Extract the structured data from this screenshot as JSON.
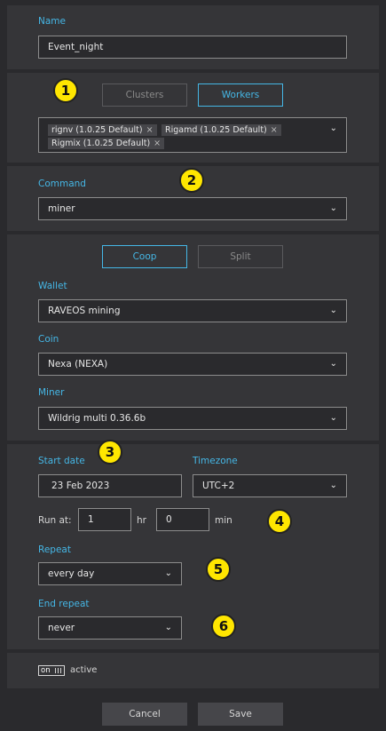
{
  "name": {
    "label": "Name",
    "value": "Event_night"
  },
  "target": {
    "options": [
      "Clusters",
      "Workers"
    ],
    "selected": "Workers",
    "tags": [
      "rignv (1.0.25 Default)",
      "Rigamd (1.0.25 Default)",
      "Rigmix (1.0.25 Default)"
    ],
    "remove_glyph": "×"
  },
  "command": {
    "label": "Command",
    "value": "miner"
  },
  "mode": {
    "options": [
      "Coop",
      "Split"
    ],
    "selected": "Coop"
  },
  "wallet": {
    "label": "Wallet",
    "value": "RAVEOS mining"
  },
  "coin": {
    "label": "Coin",
    "value": "Nexa (NEXA)"
  },
  "miner": {
    "label": "Miner",
    "value": "Wildrig multi 0.36.6b"
  },
  "schedule": {
    "start_date_label": "Start date",
    "start_date": "23 Feb 2023",
    "timezone_label": "Timezone",
    "timezone": "UTC+2",
    "run_at_label": "Run at:",
    "hours": "1",
    "hr_unit": "hr",
    "minutes": "0",
    "min_unit": "min",
    "repeat_label": "Repeat",
    "repeat": "every day",
    "end_repeat_label": "End repeat",
    "end_repeat": "never"
  },
  "status": {
    "toggle_text": "on",
    "label": "active"
  },
  "actions": {
    "cancel": "Cancel",
    "save": "Save"
  },
  "markers": [
    "1",
    "2",
    "3",
    "4",
    "5",
    "6"
  ],
  "icons": {
    "dropdown": "chevron-down-icon"
  },
  "colors": {
    "accent": "#45b7e6",
    "marker": "#ffe600",
    "panel": "#353538",
    "background": "#2a2a2d"
  }
}
